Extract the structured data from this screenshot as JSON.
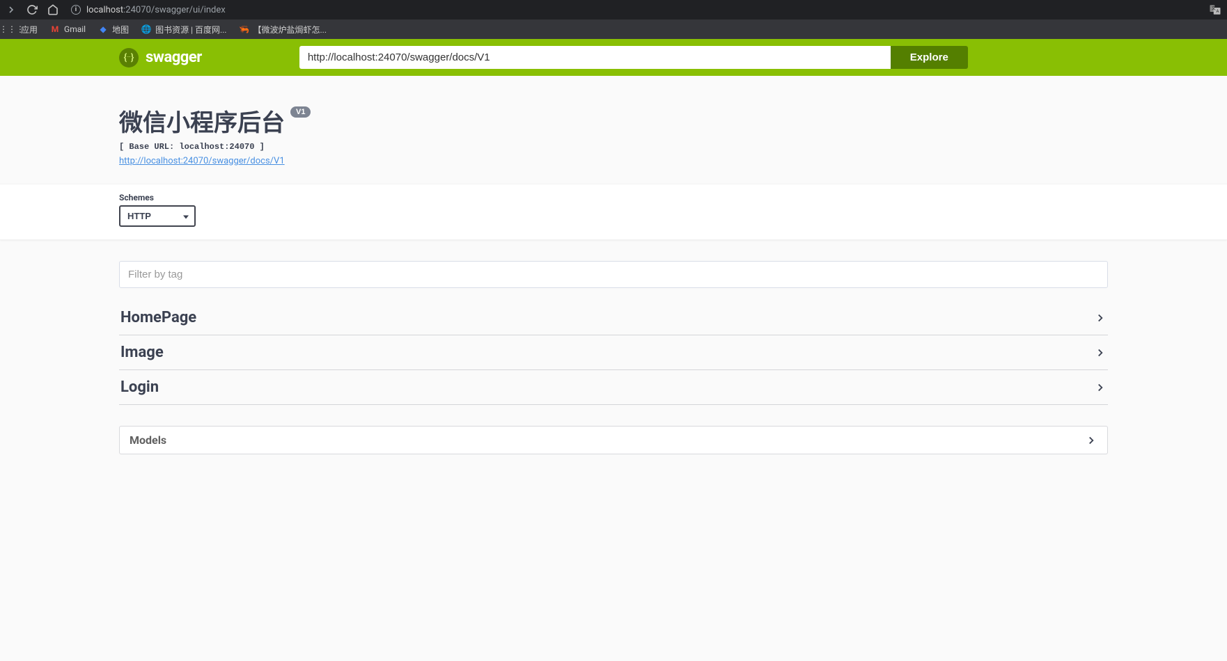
{
  "browser": {
    "url_host": "localhost",
    "url_port_path": ":24070/swagger/ui/index",
    "bookmarks": [
      {
        "label": "应用",
        "icon": "apps"
      },
      {
        "label": "Gmail",
        "icon": "gmail"
      },
      {
        "label": "地图",
        "icon": "maps"
      },
      {
        "label": "图书资源 | 百度网...",
        "icon": "globe"
      },
      {
        "label": "【微波炉盐焗虾怎...",
        "icon": "cook"
      }
    ]
  },
  "topbar": {
    "logo_text": "swagger",
    "url_input_value": "http://localhost:24070/swagger/docs/V1",
    "explore_label": "Explore"
  },
  "info": {
    "title": "微信小程序后台",
    "version": "V1",
    "base_url": "[ Base URL: localhost:24070 ]",
    "docs_link": "http://localhost:24070/swagger/docs/V1"
  },
  "schemes": {
    "label": "Schemes",
    "selected": "HTTP"
  },
  "filter": {
    "placeholder": "Filter by tag"
  },
  "tags": [
    {
      "name": "HomePage"
    },
    {
      "name": "Image"
    },
    {
      "name": "Login"
    }
  ],
  "models": {
    "title": "Models"
  }
}
